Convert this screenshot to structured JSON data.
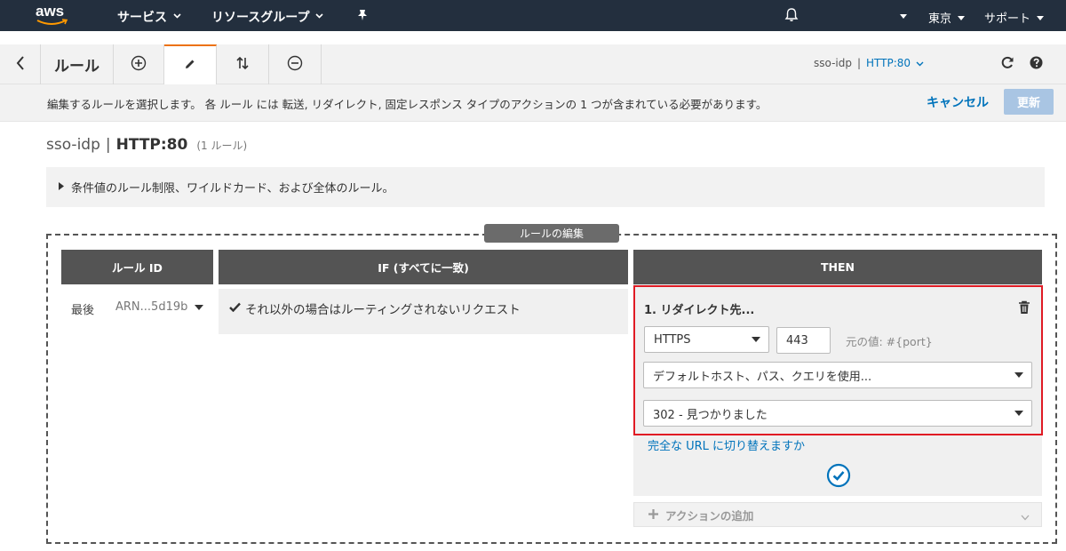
{
  "topnav": {
    "logo": "aws",
    "services": "サービス",
    "resource_groups": "リソースグループ",
    "region": "東京",
    "support": "サポート",
    "icons": [
      "chevron-down-icon",
      "pin-icon",
      "bell-icon"
    ]
  },
  "toolbar": {
    "title": "ルール",
    "listener_name": "sso-idp",
    "separator": "|",
    "listener_port": "HTTP:80",
    "icons": [
      "back-icon",
      "add-icon",
      "edit-icon",
      "sort-icon",
      "remove-icon",
      "refresh-icon",
      "help-icon"
    ]
  },
  "infobar": {
    "message": "編集するルールを選択します。 各 ルール には 転送, リダイレクト, 固定レスポンス タイプのアクションの 1 つが含まれている必要があります。",
    "cancel": "キャンセル",
    "update": "更新"
  },
  "page": {
    "listener_name": "sso-idp",
    "separator": "|",
    "listener_port": "HTTP:80",
    "rule_count": "(1 ルール)"
  },
  "expander": {
    "label": "条件値のルール制限、ワイルドカード、および全体のルール。"
  },
  "editor": {
    "tab_label": "ルールの編集",
    "columns": {
      "rule_id": "ルール ID",
      "if": "IF (すべてに一致)",
      "then": "THEN"
    },
    "rule": {
      "priority": "最後",
      "arn": "ARN...5d19b",
      "condition": "それ以外の場合はルーティングされないリクエスト"
    },
    "action": {
      "title": "1. リダイレクト先...",
      "protocol": "HTTPS",
      "port": "443",
      "original_value": "元の値: #{port}",
      "host_path": "デフォルトホスト、パス、クエリを使用...",
      "status_code": "302 - 見つかりました",
      "switch_full_url": "完全な URL に切り替えますか",
      "add_action": "アクションの追加"
    }
  },
  "colors": {
    "topnav_bg": "#232f3e",
    "accent_orange": "#ec7211",
    "link_blue": "#0073bb",
    "highlight_red": "#e01b24",
    "column_header": "#545454"
  }
}
